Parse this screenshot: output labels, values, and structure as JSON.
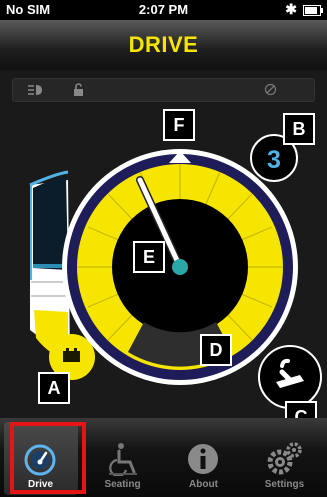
{
  "status_bar": {
    "carrier": "No SIM",
    "time": "2:07 PM",
    "bluetooth": "✱"
  },
  "title": "DRIVE",
  "toolbar": {
    "lights_icon": "headlight-icon",
    "lock_icon": "unlock-icon",
    "disabled_icon": "no-sign-icon"
  },
  "drive": {
    "speed_setting": "3"
  },
  "labels": {
    "a": "A",
    "b": "B",
    "c": "C",
    "d": "D",
    "e": "E",
    "f": "F"
  },
  "colors": {
    "accent": "#f6e500",
    "dial_ring": "#1f1c5a",
    "needle_hub": "#2aa7a7",
    "speed_gauge_border": "#4fb3e8",
    "highlight": "#e51515"
  },
  "tabs": [
    {
      "label": "Drive",
      "icon": "speedometer-icon",
      "active": true
    },
    {
      "label": "Seating",
      "icon": "wheelchair-icon",
      "active": false
    },
    {
      "label": "About",
      "icon": "info-icon",
      "active": false
    },
    {
      "label": "Settings",
      "icon": "gears-icon",
      "active": false
    }
  ]
}
